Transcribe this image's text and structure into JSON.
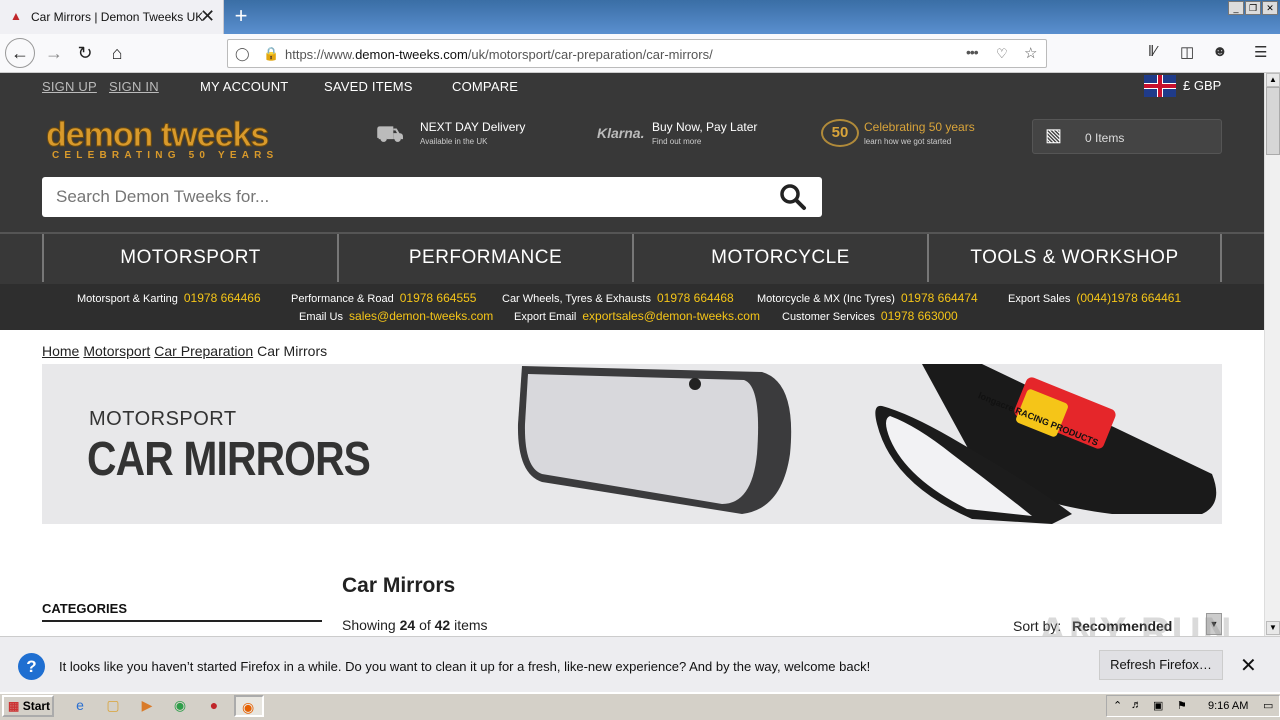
{
  "browser": {
    "tab_title": "Car Mirrors | Demon Tweeks UK",
    "new_tab": "+",
    "url_prefix": "https://www.",
    "url_domain": "demon-tweeks.com",
    "url_path": "/uk/motorsport/car-preparation/car-mirrors/",
    "more_icon": "•••"
  },
  "top_links": {
    "sign_up": "SIGN UP",
    "sign_in": "SIGN IN",
    "my_account": "MY ACCOUNT",
    "saved_items": "SAVED ITEMS",
    "compare": "COMPARE",
    "currency": "£ GBP"
  },
  "logo": {
    "name": "demon tweeks",
    "tagline": "CELEBRATING 50 YEARS"
  },
  "features": [
    {
      "title": "NEXT DAY Delivery",
      "sub": "Available in the UK"
    },
    {
      "brand": "Klarna.",
      "title": "Buy Now, Pay Later",
      "sub": "Find out more"
    },
    {
      "badge": "50",
      "title": "Celebrating 50 years",
      "sub": "learn how we got started"
    }
  ],
  "basket": {
    "label": "0 Items"
  },
  "search": {
    "placeholder": "Search Demon Tweeks for..."
  },
  "menu": [
    "MOTORSPORT",
    "PERFORMANCE",
    "MOTORCYCLE",
    "TOOLS & WORKSHOP"
  ],
  "contacts_row1": [
    {
      "label": "Motorsport & Karting",
      "value": "01978 664466"
    },
    {
      "label": "Performance & Road",
      "value": "01978 664555"
    },
    {
      "label": "Car Wheels, Tyres & Exhausts",
      "value": "01978 664468"
    },
    {
      "label": "Motorcycle & MX (Inc Tyres)",
      "value": "01978 664474"
    },
    {
      "label": "Export Sales",
      "value": "(0044)1978 664461"
    }
  ],
  "contacts_row2": [
    {
      "label": "Email Us",
      "value": "sales@demon-tweeks.com"
    },
    {
      "label": "Export Email",
      "value": "exportsales@demon-tweeks.com"
    },
    {
      "label": "Customer Services",
      "value": "01978 663000"
    }
  ],
  "breadcrumb": [
    "Home",
    "Motorsport",
    "Car Preparation",
    "Car Mirrors"
  ],
  "banner": {
    "kicker": "MOTORSPORT",
    "title": "CAR MIRRORS",
    "product_label": "longacre RACING PRODUCTS"
  },
  "page_title": "Car Mirrors",
  "categories_heading": "CATEGORIES",
  "showing": {
    "prefix": "Showing",
    "count": "24",
    "of": "of",
    "total": "42",
    "suffix": "items"
  },
  "sort": {
    "label": "Sort by:",
    "value": "Recommended"
  },
  "notification": {
    "message": "It looks like you haven’t started Firefox in a while. Do you want to clean it up for a fresh, like-new experience? And by the way, welcome back!",
    "button": "Refresh Firefox…"
  },
  "watermark": "ANY RUN",
  "taskbar": {
    "start": "Start",
    "clock": "9:16 AM"
  },
  "colors": {
    "header_bg": "#383838",
    "accent_yellow": "#f5c518",
    "logo_gold": "#d99a2b"
  }
}
